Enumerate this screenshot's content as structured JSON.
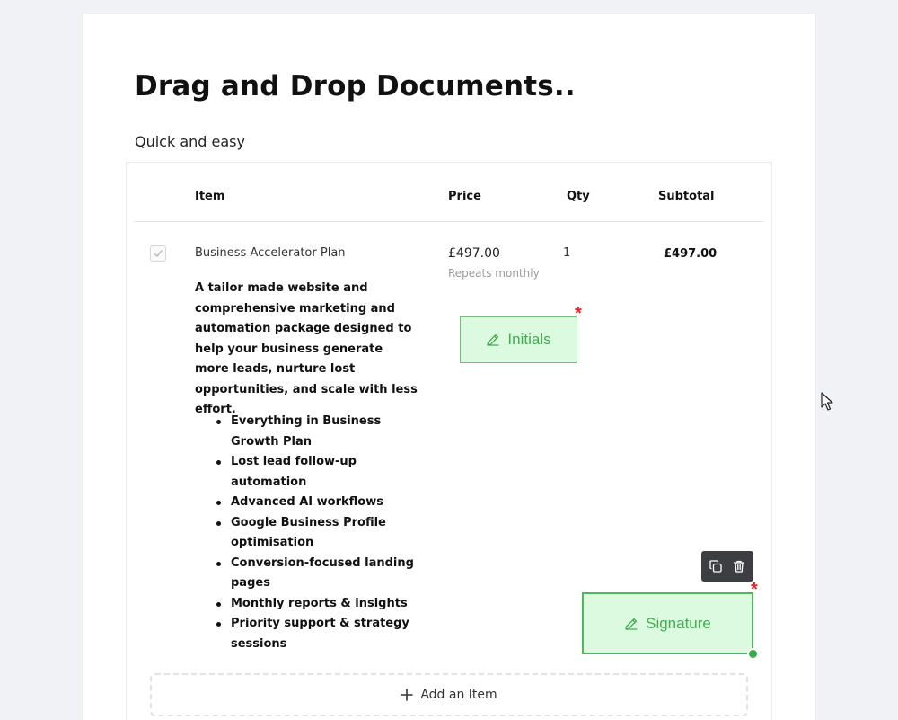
{
  "document": {
    "title": "Drag and Drop Documents..",
    "subtitle": "Quick and easy"
  },
  "table": {
    "headers": {
      "item": "Item",
      "price": "Price",
      "qty": "Qty",
      "subtotal": "Subtotal"
    },
    "rows": [
      {
        "checked": true,
        "name": "Business Accelerator Plan",
        "description": "A tailor made website and comprehensive marketing and automation package designed to help your business generate more leads, nurture lost opportunities, and scale with less effort.",
        "features": [
          "Everything in Business Growth Plan",
          "Lost lead follow-up automation",
          "Advanced AI workflows",
          "Google Business Profile optimisation",
          "Conversion-focused landing pages",
          "Monthly reports & insights",
          "Priority support & strategy sessions"
        ],
        "price": "£497.00",
        "price_note": "Repeats monthly",
        "qty": "1",
        "subtotal": "£497.00"
      }
    ],
    "add_item_label": "Add an Item"
  },
  "fields": {
    "initials": {
      "label": "Initials",
      "required_mark": "*",
      "icon": "pen-icon"
    },
    "signature": {
      "label": "Signature",
      "required_mark": "*",
      "icon": "pen-icon"
    }
  },
  "toolbar": {
    "icons": [
      "copy-icon",
      "trash-icon"
    ]
  },
  "colors": {
    "field_bg": "#dcfadf",
    "field_border": "#4cb85a",
    "field_text": "#3fae4f",
    "required": "#e02424",
    "toolbar_bg": "#3d3e42"
  }
}
